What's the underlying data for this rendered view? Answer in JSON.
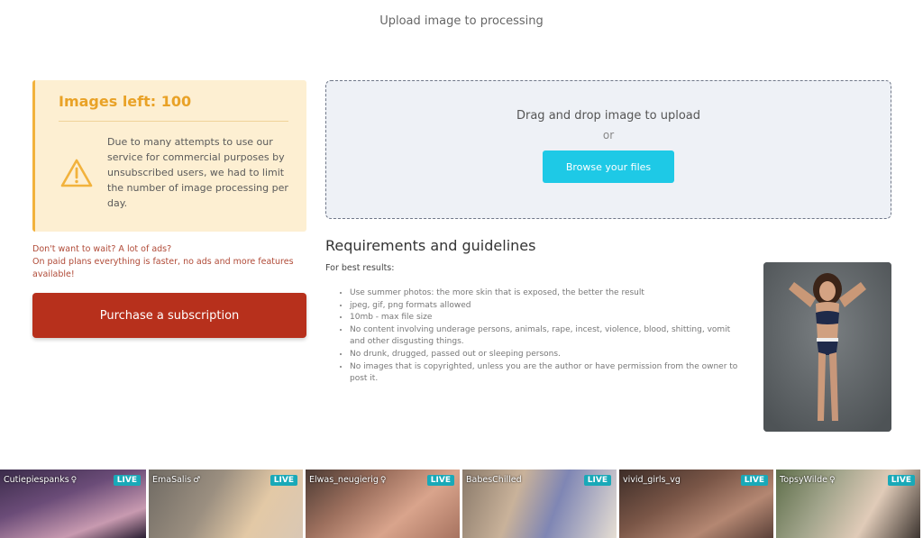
{
  "page": {
    "title": "Upload image to processing"
  },
  "notice": {
    "title": "Images left: 100",
    "text": "Due to many attempts to use our service for commercial purposes by unsubscribed users, we had to limit the number of image processing per day.",
    "icon": "warning-icon",
    "accent": "#f2b23c"
  },
  "promo": {
    "line1": "Don't want to wait? A lot of ads?",
    "line2": "On paid plans everything is faster, no ads and more features available!"
  },
  "purchase": {
    "label": "Purchase a subscription",
    "color": "#b7301c"
  },
  "dropzone": {
    "heading": "Drag and drop image to upload",
    "or": "or",
    "browse_label": "Browse your files",
    "browse_color": "#1ec9e6"
  },
  "requirements": {
    "title": "Requirements and guidelines",
    "subtitle": "For best results:",
    "items": [
      "Use summer photos: the more skin that is exposed, the better the result",
      "jpeg, gif, png formats allowed",
      "10mb - max file size",
      "No content involving underage persons, animals, rape, incest, violence, blood, shitting, vomit and other disgusting things.",
      "No drunk, drugged, passed out or sleeping persons.",
      "No images that is copyrighted, unless you are the author or have permission from the owner to post it."
    ]
  },
  "live_strip": {
    "badge": "LIVE",
    "tiles": [
      {
        "name": "Cutiepiespanks",
        "gender": "♀"
      },
      {
        "name": "EmaSalis",
        "gender": "♂"
      },
      {
        "name": "Elwas_neugierig",
        "gender": "♀"
      },
      {
        "name": "BabesChilled",
        "gender": ""
      },
      {
        "name": "vivid_girls_vg",
        "gender": ""
      },
      {
        "name": "TopsyWilde",
        "gender": "♀"
      }
    ]
  }
}
